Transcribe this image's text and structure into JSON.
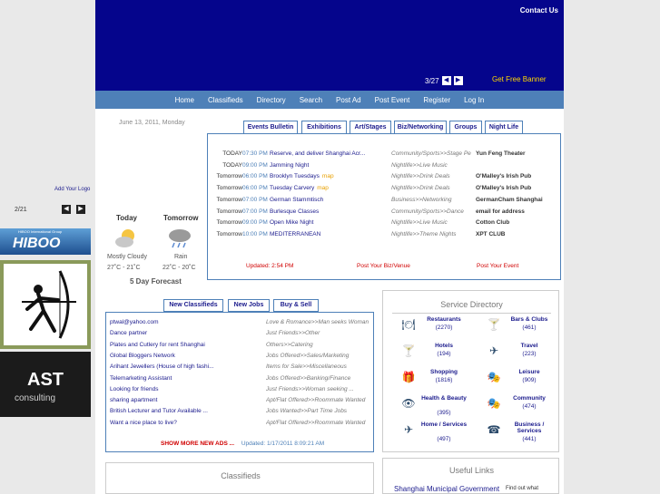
{
  "header": {
    "contact": "Contact Us",
    "pager": "3/27",
    "free_banner": "Get Free Banner"
  },
  "nav": [
    "Home",
    "Classifieds",
    "Directory",
    "Search",
    "Post Ad",
    "Post Event",
    "Register",
    "Log In"
  ],
  "left": {
    "add_logo": "Add Your Logo",
    "pager": "2/21",
    "hiboo_small": "HIBOO International Group",
    "hiboo_big": "HIBOO",
    "ast_big": "AST",
    "ast_small": "consulting"
  },
  "date": "June 13, 2011, Monday",
  "weather": {
    "today_label": "Today",
    "tomorrow_label": "Tomorrow",
    "today_cond": "Mostly Cloudy",
    "today_temp": "27˚C - 21˚C",
    "tomorrow_cond": "Rain",
    "tomorrow_temp": "22˚C - 20˚C",
    "forecast": "5 Day Forecast"
  },
  "event_tabs": [
    "Events Bulletin",
    "Exhibitions",
    "Art/Stages",
    "Biz/Networking",
    "Groups",
    "Night Life"
  ],
  "events": [
    {
      "day": "TODAY",
      "time": "07:30 PM",
      "title": "Reserve, and deliver Shanghai Acr...",
      "map": "",
      "cat": "Community/Sports>>Stage Per...",
      "venue": "Yun Feng Theater"
    },
    {
      "day": "TODAY",
      "time": "09:00 PM",
      "title": "Jamming Night",
      "map": "",
      "cat": "Nightlife>>Live Music",
      "venue": ""
    },
    {
      "day": "Tomorrow",
      "time": "06:00 PM",
      "title": "Brooklyn Tuesdays",
      "map": "map",
      "cat": "Nightlife>>Drink Deals",
      "venue": "O'Malley's Irish Pub"
    },
    {
      "day": "Tomorrow",
      "time": "06:00 PM",
      "title": "Tuesday Carvery",
      "map": "map",
      "cat": "Nightlife>>Drink Deals",
      "venue": "O'Malley's Irish Pub"
    },
    {
      "day": "Tomorrow",
      "time": "07:00 PM",
      "title": "German Stammtisch",
      "map": "",
      "cat": "Business>>Networking",
      "venue": "GermanCham Shanghai"
    },
    {
      "day": "Tomorrow",
      "time": "07:00 PM",
      "title": "Burlesque Classes",
      "map": "",
      "cat": "Community/Sports>>Dance",
      "venue": "email for address"
    },
    {
      "day": "Tomorrow",
      "time": "09:00 PM",
      "title": "Open Mike Night",
      "map": "",
      "cat": "Nightlife>>Live Music",
      "venue": "Cotton Club"
    },
    {
      "day": "Tomorrow",
      "time": "10:00 PM",
      "title": "MEDITERRANEAN",
      "map": "",
      "cat": "Nightlife>>Theme Nights",
      "venue": "XPT CLUB"
    }
  ],
  "event_footer": {
    "updated": "Updated: 2:54 PM",
    "post_biz": "Post Your Biz/Venue",
    "post_event": "Post Your Event"
  },
  "class_tabs": [
    "New Classifieds",
    "New Jobs",
    "Buy & Sell"
  ],
  "classifieds": [
    {
      "title": "ptwal@yahoo.com",
      "cat": "Love & Romance>>Man seeks Woman"
    },
    {
      "title": "Dance partner",
      "cat": "Just Friends>>Other"
    },
    {
      "title": "Plates and Cutlery for rent Shanghai",
      "cat": "Others>>Catering"
    },
    {
      "title": "Global Bloggers Network",
      "cat": "Jobs Offered>>Sales/Marketing"
    },
    {
      "title": "Arihant Jewellers (House of high fashi...",
      "cat": "Items for Sale>>Miscellaneous"
    },
    {
      "title": "Telemarketing Assistant",
      "cat": "Jobs Offered>>Banking/Finance"
    },
    {
      "title": "Looking for friends",
      "cat": "Just Friends>>Woman seeking ..."
    },
    {
      "title": "sharing apartment",
      "cat": "Apt/Flat Offered>>Roommate Wanted"
    },
    {
      "title": "British Lecturer and Tutor Available ...",
      "cat": "Jobs Wanted>>Part Time Jobs"
    },
    {
      "title": "Want a nice place to live?",
      "cat": "Apt/Flat Offered>>Roommate Wanted"
    }
  ],
  "class_footer": {
    "more": "SHOW MORE NEW ADS ...",
    "updated": "Updated: 1/17/2011 8:09:21 AM"
  },
  "service": {
    "title": "Service Directory",
    "items": [
      {
        "name": "Restaurants",
        "count": "(2270)",
        "icon": "restaurant-icon",
        "glyph": "🍽"
      },
      {
        "name": "Bars & Clubs",
        "count": "(461)",
        "icon": "cocktail-icon",
        "glyph": "🍸"
      },
      {
        "name": "Hotels",
        "count": "(194)",
        "icon": "hotel-icon",
        "glyph": "🍸"
      },
      {
        "name": "Travel",
        "count": "(223)",
        "icon": "plane-icon",
        "glyph": "✈"
      },
      {
        "name": "Shopping",
        "count": "(1816)",
        "icon": "shopping-icon",
        "glyph": "🎁"
      },
      {
        "name": "Leisure",
        "count": "(909)",
        "icon": "leisure-icon",
        "glyph": "🎭"
      },
      {
        "name": "Health & Beauty",
        "count": "(395)",
        "icon": "eye-icon",
        "glyph": "👁"
      },
      {
        "name": "Community",
        "count": "(474)",
        "icon": "community-icon",
        "glyph": "🎭"
      },
      {
        "name": "Home / Services",
        "count": "(497)",
        "icon": "home-services-icon",
        "glyph": "✈"
      },
      {
        "name": "Business / Services",
        "count": "(441)",
        "icon": "telephone-icon",
        "glyph": "☎"
      }
    ]
  },
  "classifieds_box_title": "Classifieds",
  "useful": {
    "title": "Useful Links",
    "link": "Shanghai Municipal Government",
    "desc": "Find out what"
  },
  "colors": {
    "banner": "#05058c",
    "nav": "#4e80b8",
    "alert": "#d00000"
  }
}
